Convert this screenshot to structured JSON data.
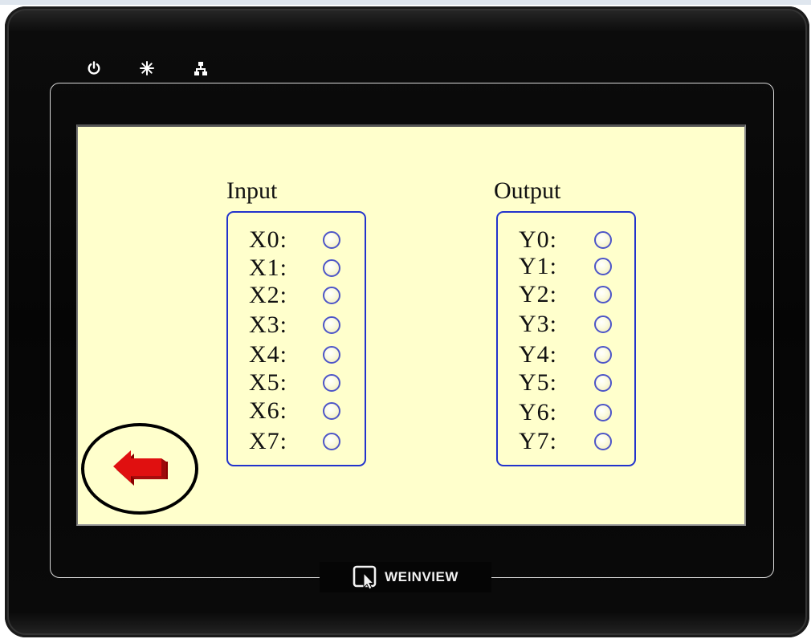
{
  "hmi": {
    "brand": "WEINVIEW",
    "status_icons": [
      "power-icon",
      "sun-icon",
      "network-icon"
    ],
    "colors": {
      "screen_bg": "#ffffcc",
      "box_border": "#2233cc",
      "lamp_off": "#fcfce4",
      "back_arrow": "#dd1111"
    }
  },
  "input": {
    "title": "Input",
    "items": [
      {
        "label": "X0:",
        "state": "off"
      },
      {
        "label": "X1:",
        "state": "off"
      },
      {
        "label": "X2:",
        "state": "off"
      },
      {
        "label": "X3:",
        "state": "off"
      },
      {
        "label": "X4:",
        "state": "off"
      },
      {
        "label": "X5:",
        "state": "off"
      },
      {
        "label": "X6:",
        "state": "off"
      },
      {
        "label": "X7:",
        "state": "off"
      }
    ]
  },
  "output": {
    "title": "Output",
    "items": [
      {
        "label": "Y0:",
        "state": "off"
      },
      {
        "label": "Y1:",
        "state": "off"
      },
      {
        "label": "Y2:",
        "state": "off"
      },
      {
        "label": "Y3:",
        "state": "off"
      },
      {
        "label": "Y4:",
        "state": "off"
      },
      {
        "label": "Y5:",
        "state": "off"
      },
      {
        "label": "Y6:",
        "state": "off"
      },
      {
        "label": "Y7:",
        "state": "off"
      }
    ]
  },
  "navigation": {
    "back_icon": "back-arrow-icon"
  }
}
